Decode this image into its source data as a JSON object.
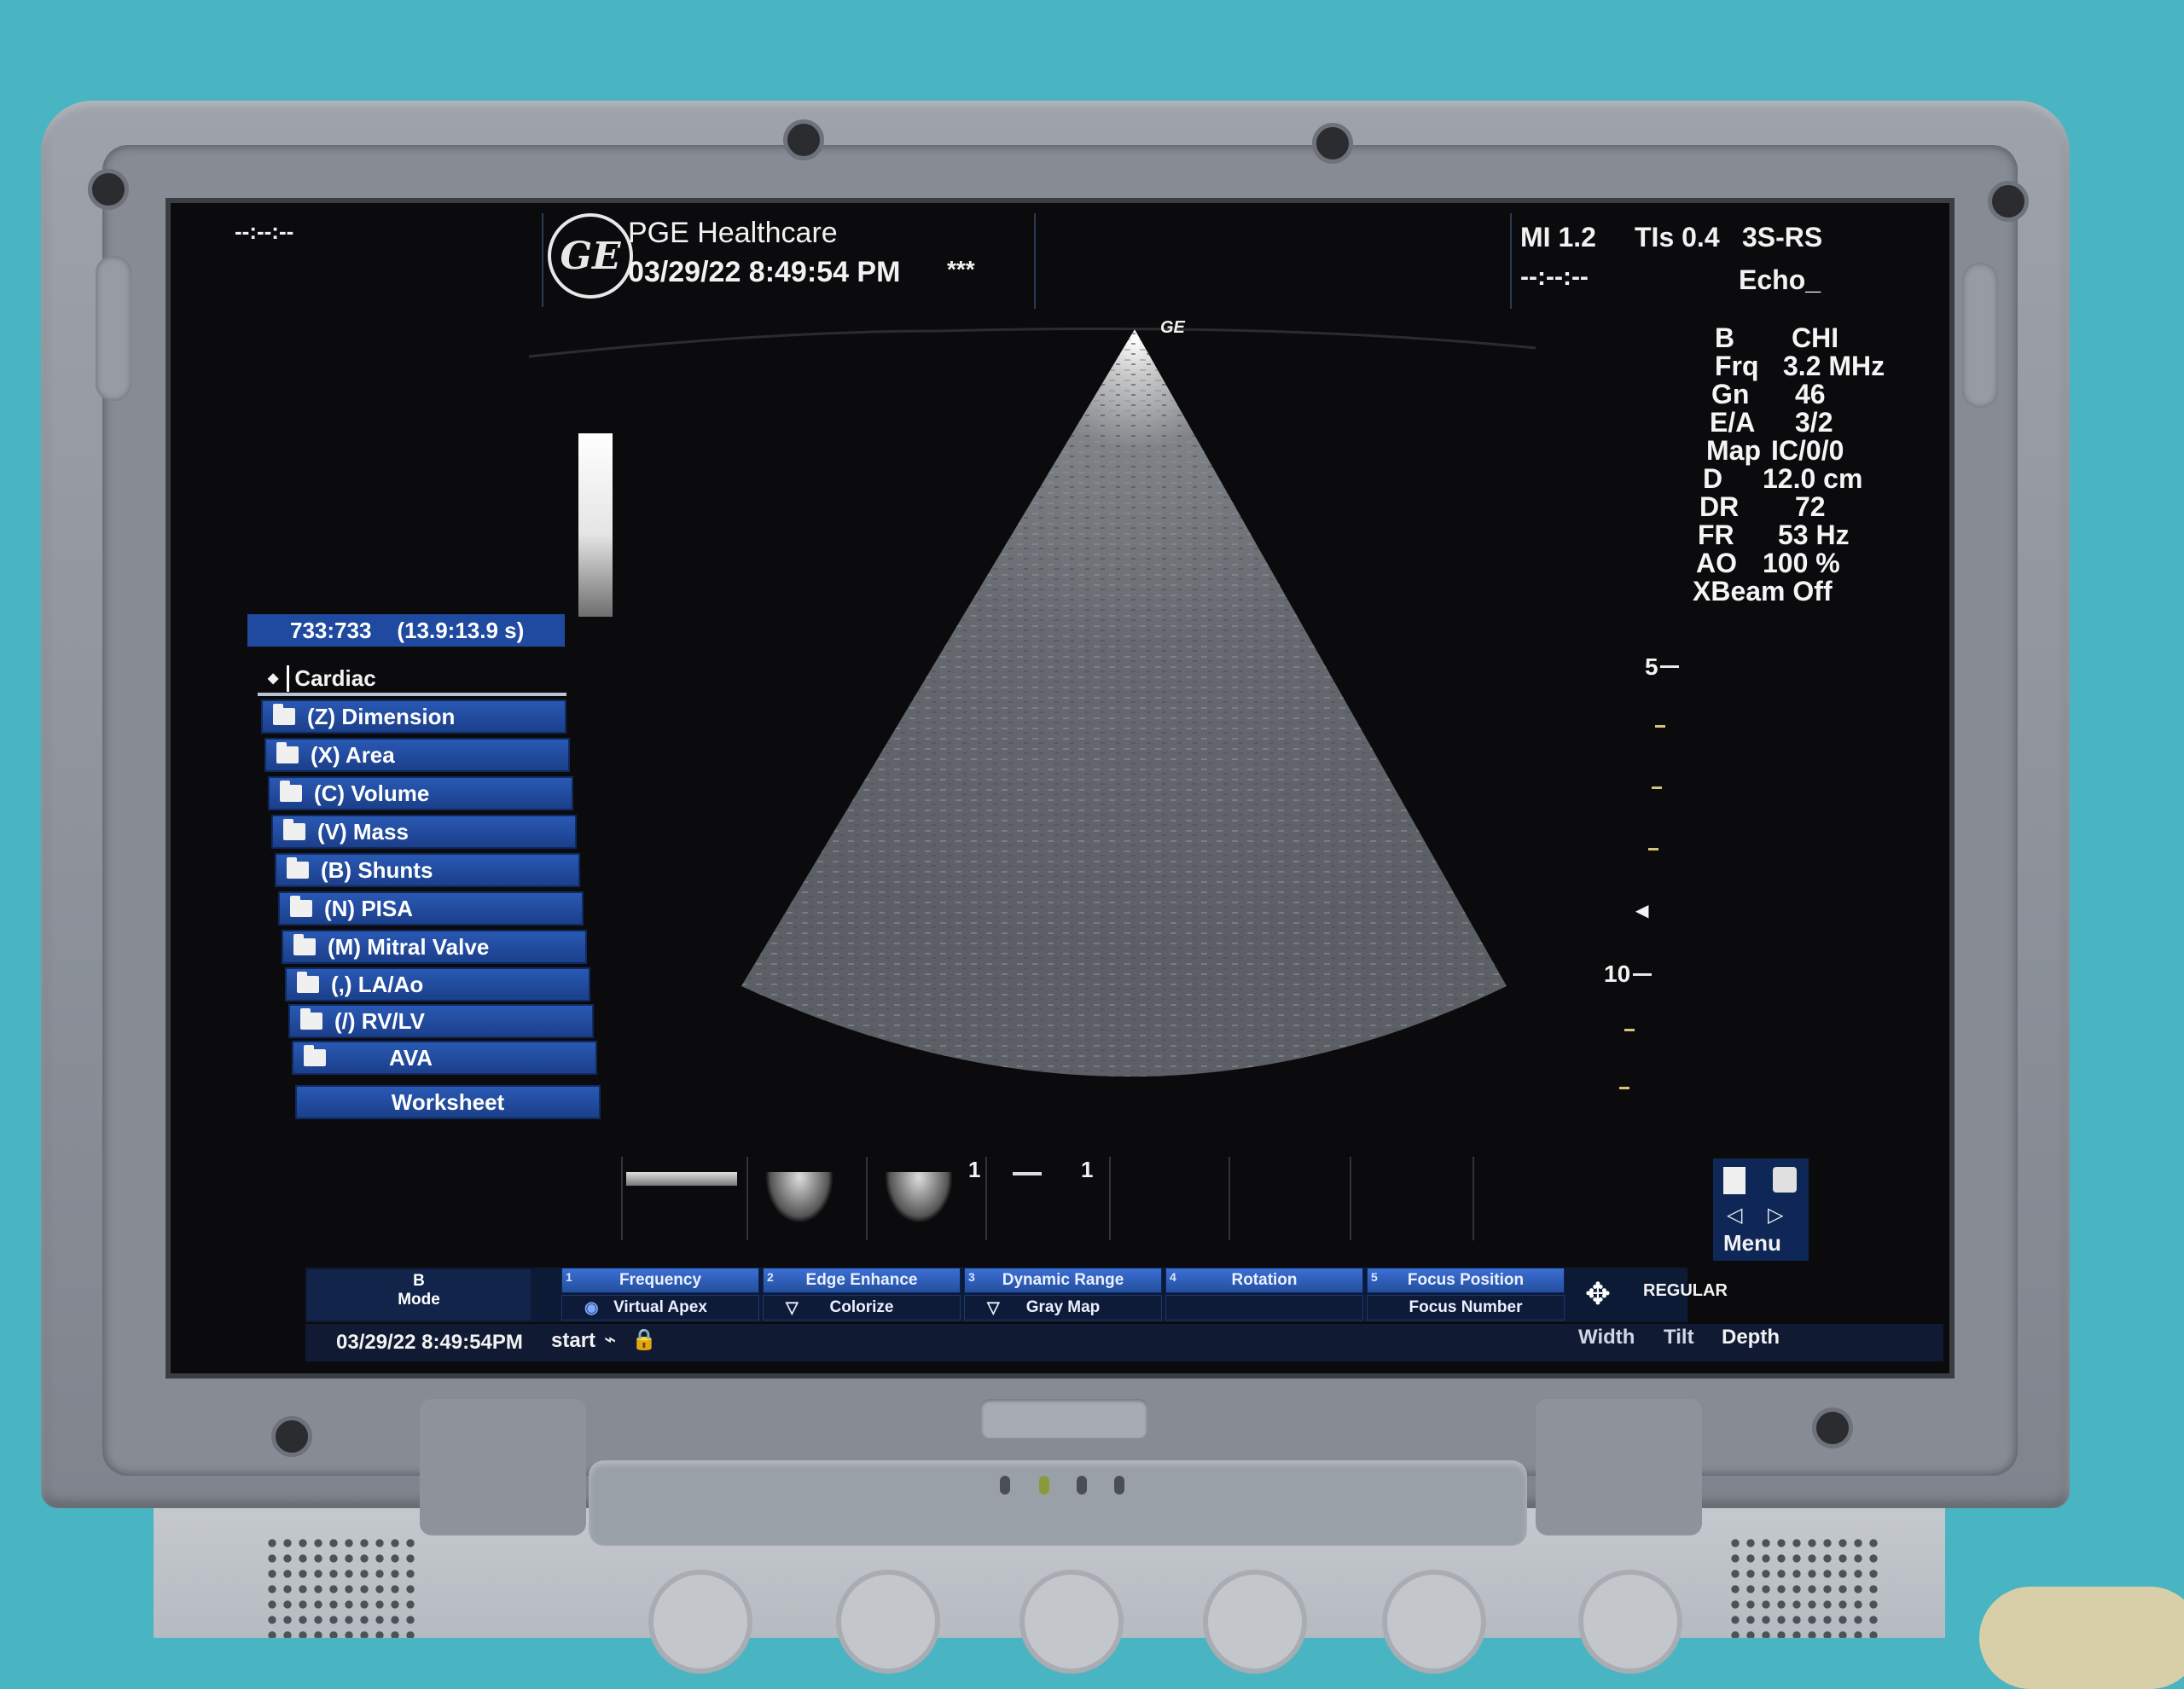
{
  "header": {
    "top_left_placeholder": "--:--:--",
    "brand": "PGE Healthcare",
    "datetime": "03/29/22 8:49:54 PM",
    "stars": "***",
    "mi": "MI 1.2",
    "tis": "TIs 0.4",
    "probe": "3S-RS",
    "right_placeholder": "--:--:--",
    "preset": "Echo_"
  },
  "image_params": [
    {
      "label": "B",
      "value": "CHI"
    },
    {
      "label": "Frq",
      "value": "3.2 MHz"
    },
    {
      "label": "Gn",
      "value": "46"
    },
    {
      "label": "E/A",
      "value": "3/2"
    },
    {
      "label": "Map",
      "value": "IC/0/0"
    },
    {
      "label": "D",
      "value": "12.0 cm"
    },
    {
      "label": "DR",
      "value": "72"
    },
    {
      "label": "FR",
      "value": "53 Hz"
    },
    {
      "label": "AO",
      "value": "100 %"
    },
    {
      "label": "XBeam Off",
      "value": ""
    }
  ],
  "depth_scale": {
    "label_5": "5",
    "label_10": "10"
  },
  "sector_marker": "GE",
  "cine": {
    "frames": "733:733",
    "time": "(13.9:13.9 s)"
  },
  "measure_menu": {
    "category": "Cardiac",
    "items": [
      "(Z) Dimension",
      "(X) Area",
      "(C) Volume",
      "(V) Mass",
      "(B) Shunts",
      "(N) PISA",
      "(M) Mitral Valve",
      "(,) LA/Ao",
      "(/) RV/LV",
      "AVA"
    ],
    "worksheet": "Worksheet"
  },
  "thumbnails": {
    "label_1a": "1",
    "label_1b": "1"
  },
  "right_panel": {
    "menu": "Menu"
  },
  "mode": {
    "line1": "B",
    "line2": "Mode"
  },
  "softkeys_top": [
    {
      "num": "1",
      "label": "Frequency"
    },
    {
      "num": "2",
      "label": "Edge Enhance"
    },
    {
      "num": "3",
      "label": "Dynamic Range"
    },
    {
      "num": "4",
      "label": "Rotation"
    },
    {
      "num": "5",
      "label": "Focus Position"
    }
  ],
  "softkeys_bottom": [
    "Virtual Apex",
    "Colorize",
    "Gray Map",
    "",
    "Focus Number"
  ],
  "regular": "REGULAR",
  "status": {
    "datetime": "03/29/22 8:49:54PM",
    "start": "start"
  },
  "bottom_right": [
    "Width",
    "Tilt",
    "Depth"
  ]
}
